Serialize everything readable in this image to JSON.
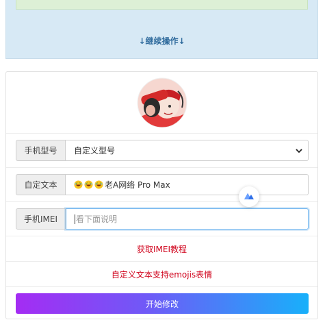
{
  "top": {
    "continue_label": "↓继续操作↓"
  },
  "form": {
    "model": {
      "label": "手机型号",
      "selected": "自定义型号"
    },
    "custom_text": {
      "label": "自定文本",
      "value": "老A网络 Pro Max"
    },
    "imei": {
      "label": "手机IMEI",
      "placeholder": "看下面说明"
    },
    "tutorial_link": "获取IMEI教程",
    "emoji_note": "自定义文本支持emojis表情",
    "submit_label": "开始修改"
  },
  "colors": {
    "top_panel": "#d7e9f5",
    "success_strip": "#ddf0d6",
    "link_blue": "#2e6a9c",
    "red_text": "#d0021b",
    "gradient_start": "#a42cf3",
    "gradient_end": "#18b0fa"
  },
  "icons": {
    "avatar": "cartoon-avatar",
    "select_caret": "chevron-down-icon",
    "emoji": "laughing-face-emoji",
    "floating_badge": "mountain-logo-icon"
  }
}
